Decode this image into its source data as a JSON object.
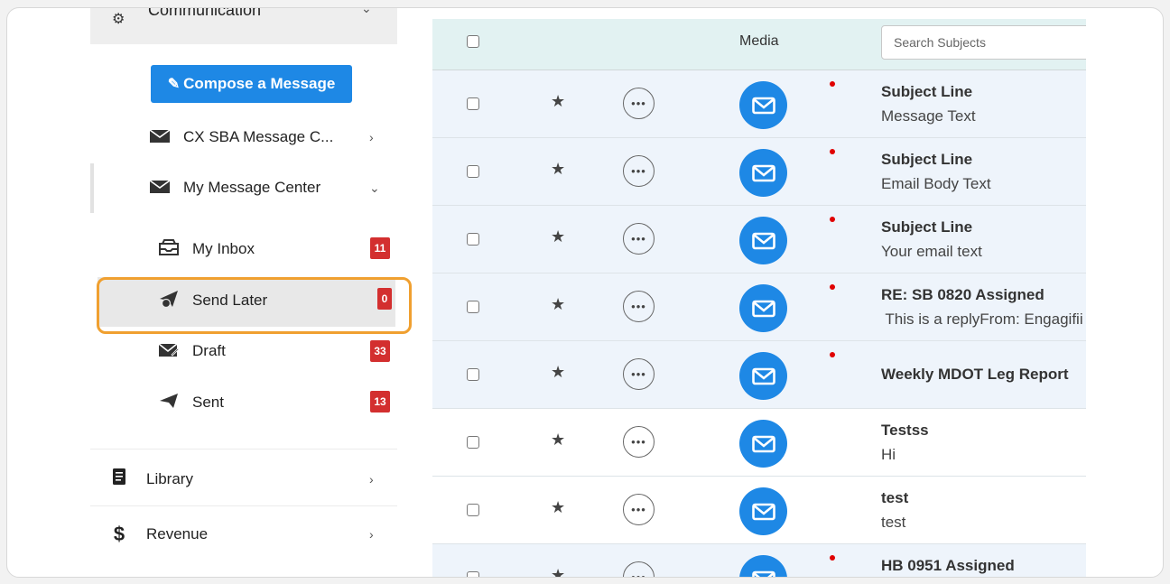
{
  "sidebar": {
    "communication": {
      "label": "Communication"
    },
    "compose_label": "Compose a Message",
    "items": [
      {
        "label": "CX SBA Message C..."
      },
      {
        "label": "My Message Center"
      },
      {
        "label": "My Inbox",
        "badge": "11"
      },
      {
        "label": "Send Later",
        "badge": "0"
      },
      {
        "label": "Draft",
        "badge": "33"
      },
      {
        "label": "Sent",
        "badge": "13"
      }
    ],
    "sections": [
      {
        "label": "Library",
        "icon": "$"
      },
      {
        "label": "Revenue",
        "icon": "$"
      }
    ]
  },
  "table": {
    "media_header": "Media",
    "search_placeholder": "Search Subjects",
    "rows": [
      {
        "subject": "Subject Line",
        "body": "Message Text"
      },
      {
        "subject": "Subject Line",
        "body": "Email Body Text"
      },
      {
        "subject": "Subject Line",
        "body": "Your email text"
      },
      {
        "subject": "RE: SB 0820 Assigned",
        "body": " This is a replyFrom: Engagifii"
      },
      {
        "subject": "Weekly MDOT Leg Report",
        "body": ""
      },
      {
        "subject": "Testss",
        "body": "Hi"
      },
      {
        "subject": "test",
        "body": "test"
      },
      {
        "subject": "HB 0951 Assigned",
        "body": ""
      }
    ]
  },
  "colors": {
    "accent": "#1e88e5",
    "badge": "#d32f2f",
    "highlight": "#f0a030",
    "header_bg": "#e2f2f2",
    "unread_dot": "#e00000"
  }
}
